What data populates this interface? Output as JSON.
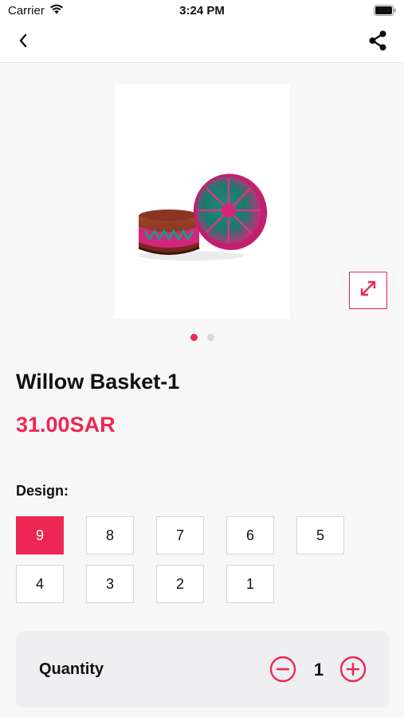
{
  "status_bar": {
    "carrier": "Carrier",
    "time": "3:24 PM"
  },
  "nav": {
    "back_icon": "chevron-left-icon",
    "share_icon": "share-icon"
  },
  "gallery": {
    "image_alt": "willow basket photo",
    "dot_count": 2,
    "active_dot": 1,
    "expand_icon": "expand-icon"
  },
  "product": {
    "title": "Willow Basket-1",
    "price": "31.00SAR"
  },
  "design": {
    "label": "Design:",
    "options": [
      "9",
      "8",
      "7",
      "6",
      "5",
      "4",
      "3",
      "2",
      "1"
    ],
    "selected": "9"
  },
  "quantity": {
    "label": "Quantity",
    "value": "1"
  },
  "colors": {
    "accent": "#ee2653",
    "background": "#f7f7f8",
    "card": "#efeff1"
  }
}
